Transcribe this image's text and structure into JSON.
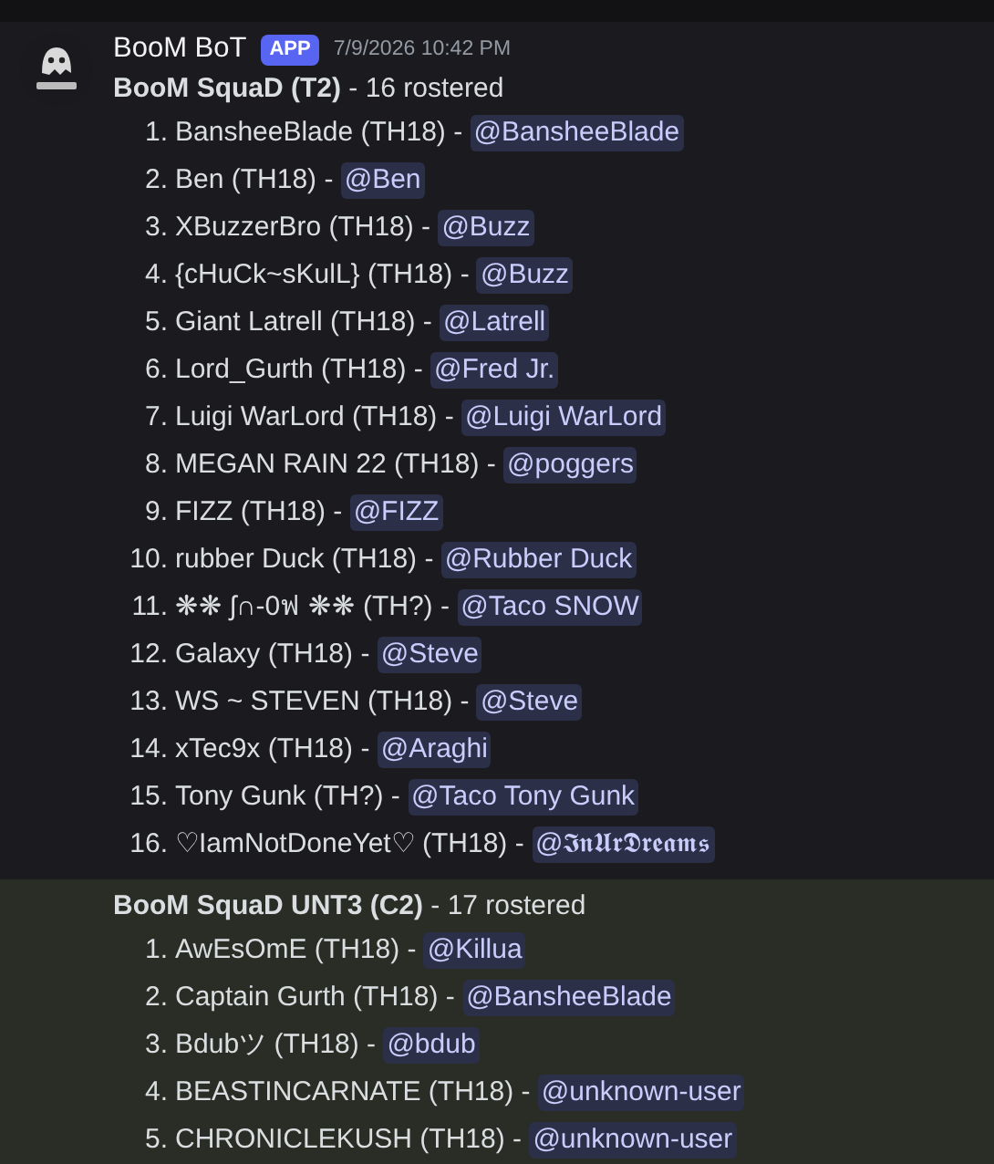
{
  "messages": [
    {
      "author": "BooM BoT",
      "badge": "APP",
      "timestamp": "7/9/2026 10:42 PM",
      "highlighted": false,
      "title": "BooM SquaD (T2)",
      "summary": " - 16 rostered",
      "items": [
        {
          "number": "1.",
          "name": "BansheeBlade (TH18) - ",
          "mention": "@BansheeBlade"
        },
        {
          "number": "2.",
          "name": "Ben (TH18) - ",
          "mention": "@Ben"
        },
        {
          "number": "3.",
          "name": "XBuzzerBro (TH18) - ",
          "mention": "@Buzz"
        },
        {
          "number": "4.",
          "name": "{cHuCk~sKulL} (TH18) - ",
          "mention": "@Buzz"
        },
        {
          "number": "5.",
          "name": "Giant Latrell (TH18) - ",
          "mention": "@Latrell"
        },
        {
          "number": "6.",
          "name": "Lord_Gurth (TH18) - ",
          "mention": "@Fred Jr."
        },
        {
          "number": "7.",
          "name": "Luigi WarLord (TH18) - ",
          "mention": "@Luigi WarLord"
        },
        {
          "number": "8.",
          "name": "MEGAN RAIN 22 (TH18) - ",
          "mention": "@poggers"
        },
        {
          "number": "9.",
          "name": "FIZZ (TH18) - ",
          "mention": "@FIZZ"
        },
        {
          "number": "10.",
          "name": "rubber Duck (TH18) - ",
          "mention": "@Rubber Duck"
        },
        {
          "number": "11.",
          "name": "❋❋ ʃ∩-0ฟ ❋❋ (TH?) - ",
          "mention": "@Taco SNOW"
        },
        {
          "number": "12.",
          "name": "Galaxy (TH18) - ",
          "mention": "@Steve"
        },
        {
          "number": "13.",
          "name": "WS ~ STEVEN (TH18) - ",
          "mention": "@Steve"
        },
        {
          "number": "14.",
          "name": "xTec9x (TH18) - ",
          "mention": "@Araghi"
        },
        {
          "number": "15.",
          "name": "Tony Gunk (TH?) - ",
          "mention": "@Taco Tony Gunk"
        },
        {
          "number": "16.",
          "name": "♡IamNotDoneYet♡ (TH18) - ",
          "mention": "@𝕴𝖓𝖀𝖗𝕯𝖗𝖊𝖆𝖒𝖘"
        }
      ]
    },
    {
      "highlighted": true,
      "title": "BooM SquaD UNT3 (C2)",
      "summary": " - 17 rostered",
      "items": [
        {
          "number": "1.",
          "name": "AwEsOmE (TH18) - ",
          "mention": "@Killua"
        },
        {
          "number": "2.",
          "name": "Captain Gurth (TH18) - ",
          "mention": "@BansheeBlade"
        },
        {
          "number": "3.",
          "name": "Bdubツ (TH18) - ",
          "mention": "@bdub"
        },
        {
          "number": "4.",
          "name": "BEASTINCARNATE (TH18) - ",
          "mention": "@unknown-user"
        },
        {
          "number": "5.",
          "name": "CHRONICLEKUSH (TH18) - ",
          "mention": "@unknown-user"
        }
      ]
    }
  ]
}
